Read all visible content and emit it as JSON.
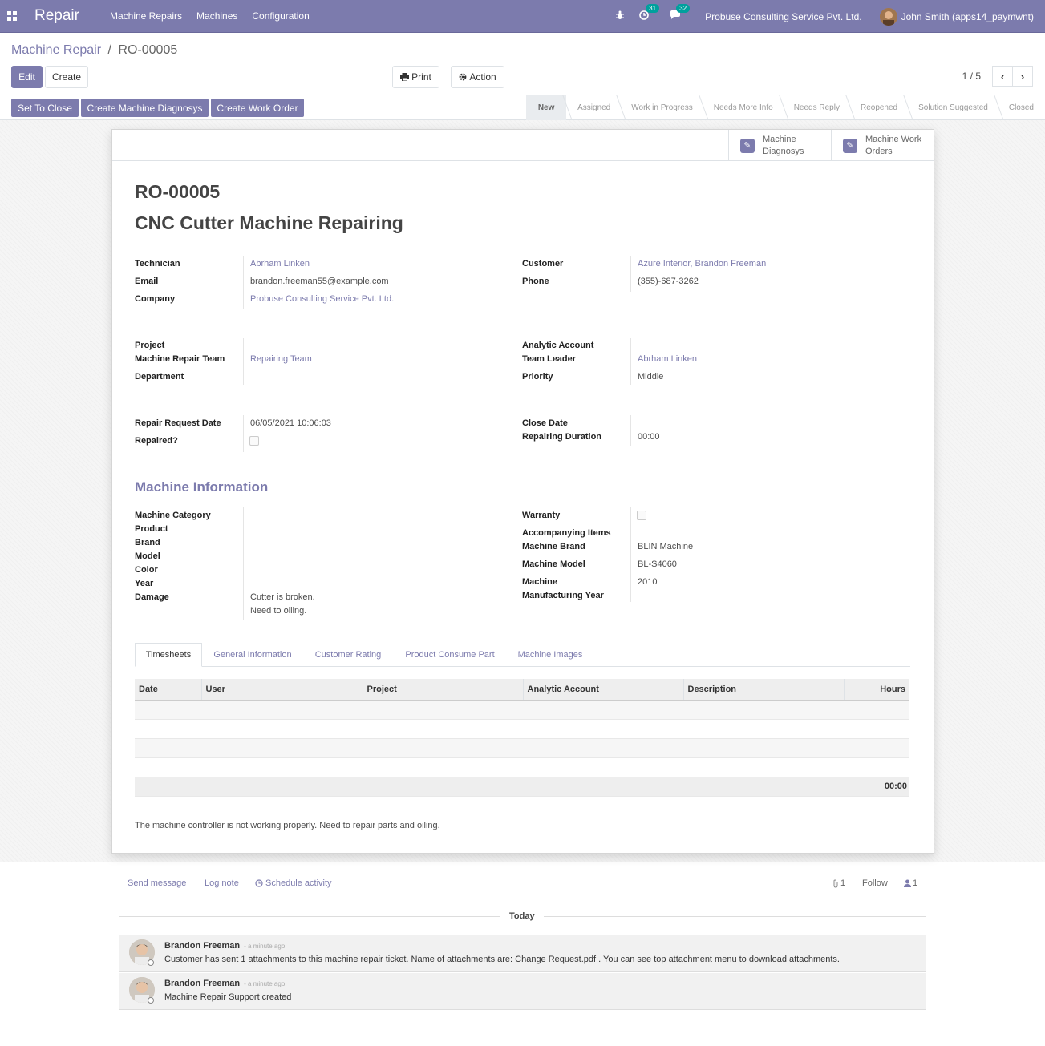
{
  "app": {
    "name": "Repair",
    "menus": [
      "Machine Repairs",
      "Machines",
      "Configuration"
    ],
    "activity_count": "31",
    "message_count": "32",
    "company": "Probuse Consulting Service Pvt. Ltd.",
    "user": "John Smith (apps14_paymwnt)"
  },
  "breadcrumb": {
    "parent": "Machine Repair",
    "separator": "/",
    "current": "RO-00005"
  },
  "buttons": {
    "edit": "Edit",
    "create": "Create",
    "print": "Print",
    "action": "Action"
  },
  "pager": {
    "value": "1 / 5"
  },
  "header_buttons": [
    "Set To Close",
    "Create Machine Diagnosys",
    "Create Work Order"
  ],
  "stages": [
    "New",
    "Assigned",
    "Work in Progress",
    "Needs More Info",
    "Needs Reply",
    "Reopened",
    "Solution Suggested",
    "Closed"
  ],
  "active_stage": "New",
  "smart_buttons": [
    {
      "line1": "Machine",
      "line2": "Diagnosys",
      "icon": "pencil-icon"
    },
    {
      "line1": "Machine Work",
      "line2": "Orders",
      "icon": "pencil-icon"
    }
  ],
  "record": {
    "ref": "RO-00005",
    "title": "CNC Cutter Machine Repairing"
  },
  "fields": {
    "technician_label": "Technician",
    "technician": "Abrham Linken",
    "email_label": "Email",
    "email": "brandon.freeman55@example.com",
    "company_label": "Company",
    "company": "Probuse Consulting Service Pvt. Ltd.",
    "customer_label": "Customer",
    "customer": "Azure Interior, Brandon Freeman",
    "phone_label": "Phone",
    "phone": "(355)-687-3262",
    "project_label": "Project",
    "team_label": "Machine Repair Team",
    "team": "Repairing Team",
    "department_label": "Department",
    "analytic_label": "Analytic Account",
    "leader_label": "Team Leader",
    "leader": "Abrham Linken",
    "priority_label": "Priority",
    "priority": "Middle",
    "request_date_label": "Repair Request Date",
    "request_date": "06/05/2021 10:06:03",
    "repaired_label": "Repaired?",
    "close_date_label": "Close Date",
    "duration_label": "Repairing Duration",
    "duration": "00:00"
  },
  "machine_info": {
    "section_title": "Machine Information",
    "category_label": "Machine Category",
    "product_label": "Product",
    "brand_label": "Brand",
    "model_label": "Model",
    "color_label": "Color",
    "year_label": "Year",
    "damage_label": "Damage",
    "damage_line1": "Cutter is broken.",
    "damage_line2": "Need to oiling.",
    "warranty_label": "Warranty",
    "accompanying_label": "Accompanying Items",
    "machine_brand_label": "Machine Brand",
    "machine_brand": "BLIN Machine",
    "machine_model_label": "Machine Model",
    "machine_model": "BL-S4060",
    "mfg_year_label1": "Machine",
    "mfg_year_label2": "Manufacturing Year",
    "mfg_year": "2010"
  },
  "tabs": [
    "Timesheets",
    "General Information",
    "Customer Rating",
    "Product Consume Part",
    "Machine Images"
  ],
  "active_tab": "Timesheets",
  "timesheet": {
    "columns": [
      "Date",
      "User",
      "Project",
      "Analytic Account",
      "Description",
      "Hours"
    ],
    "total": "00:00"
  },
  "note": "The machine controller is not working properly. Need to repair parts and oiling.",
  "chatter": {
    "send_message": "Send message",
    "log_note": "Log note",
    "schedule": "Schedule activity",
    "attachments": "1",
    "follow": "Follow",
    "followers": "1",
    "today": "Today",
    "messages": [
      {
        "author": "Brandon Freeman",
        "time": "- a minute ago",
        "body": "Customer has sent 1 attachments to this machine repair ticket. Name of attachments are: Change Request.pdf . You can see top attachment menu to download attachments."
      },
      {
        "author": "Brandon Freeman",
        "time": "- a minute ago",
        "body": "Machine Repair Support created"
      }
    ]
  }
}
